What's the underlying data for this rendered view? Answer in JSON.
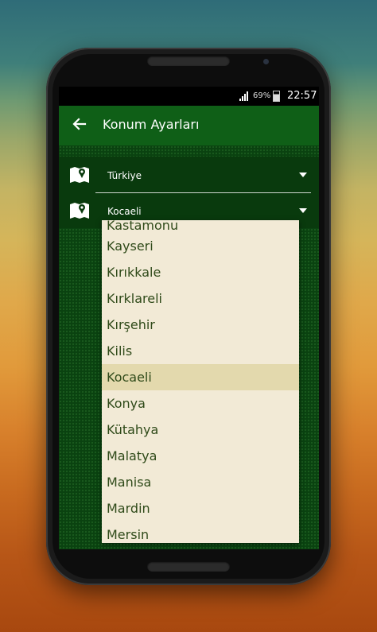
{
  "status_bar": {
    "battery_percent": "69%",
    "time": "22:57"
  },
  "app_bar": {
    "title": "Konum Ayarları"
  },
  "settings": {
    "country": "Türkiye",
    "city": "Kocaeli"
  },
  "dropdown": {
    "items": [
      "Kastamonu",
      "Kayseri",
      "Kırıkkale",
      "Kırklareli",
      "Kırşehir",
      "Kilis",
      "Kocaeli",
      "Konya",
      "Kütahya",
      "Malatya",
      "Manisa",
      "Mardin",
      "Mersin"
    ],
    "selected": "Kocaeli"
  },
  "colors": {
    "app_bar": "#0f5f17",
    "content_bg": "#0a4210",
    "dropdown_bg": "#f2ead6",
    "dropdown_selected": "#e3d9ad",
    "dropdown_text": "#2f4a19"
  },
  "icons": {
    "back": "arrow-left-icon",
    "row": "map-icon",
    "signal": "signal-icon",
    "battery": "battery-icon"
  }
}
